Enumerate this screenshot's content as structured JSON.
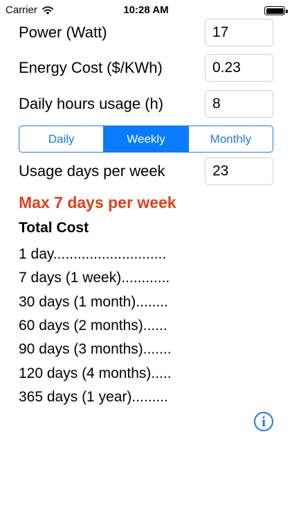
{
  "status_bar": {
    "carrier": "Carrier",
    "time": "10:28 AM"
  },
  "inputs": {
    "power": {
      "label": "Power (Watt)",
      "value": "17"
    },
    "energy_cost": {
      "label": "Energy Cost ($/KWh)",
      "value": "0.23"
    },
    "daily_hours": {
      "label": "Daily hours usage (h)",
      "value": "8"
    }
  },
  "segments": {
    "daily": "Daily",
    "weekly": "Weekly",
    "monthly": "Monthly",
    "selected": "Weekly"
  },
  "usage_days": {
    "label": "Usage days per week",
    "value": "23"
  },
  "warning": "Max 7 days per week",
  "total_cost": {
    "title": "Total Cost",
    "items": [
      "1 day............................",
      "7 days (1 week)............",
      "30 days (1 month)........",
      "60 days (2 months)......",
      "90 days (3 months).......",
      "120 days (4 months).....",
      "365 days (1 year)........."
    ]
  },
  "info_glyph": "i",
  "colors": {
    "accent": "#1a7ae8",
    "active_segment": "#0a7cff",
    "warning": "#e63d17"
  },
  "icons": [
    "wifi-icon",
    "battery-icon",
    "info-icon"
  ]
}
